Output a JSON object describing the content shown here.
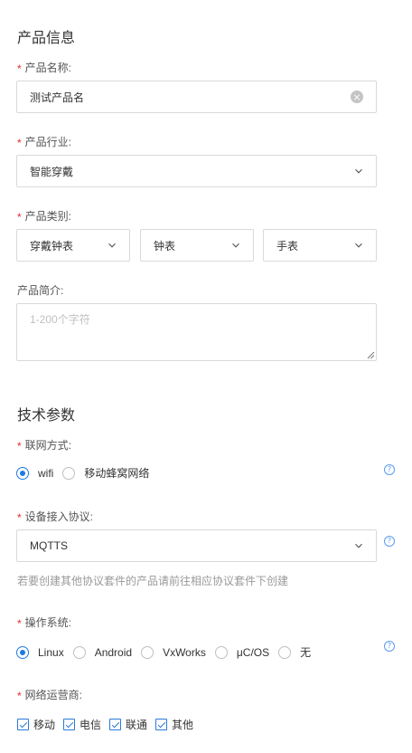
{
  "product_info": {
    "title": "产品信息",
    "name_label": "产品名称:",
    "name_value": "测试产品名",
    "industry_label": "产品行业:",
    "industry_value": "智能穿戴",
    "category_label": "产品类别:",
    "category_values": [
      "穿戴钟表",
      "钟表",
      "手表"
    ],
    "desc_label": "产品简介:",
    "desc_placeholder": "1-200个字符"
  },
  "tech_params": {
    "title": "技术参数",
    "network_label": "联网方式:",
    "network_options": [
      {
        "label": "wifi",
        "selected": true
      },
      {
        "label": "移动蜂窝网络",
        "selected": false
      }
    ],
    "protocol_label": "设备接入协议:",
    "protocol_value": "MQTTS",
    "protocol_hint": "若要创建其他协议套件的产品请前往相应协议套件下创建",
    "os_label": "操作系统:",
    "os_options": [
      {
        "label": "Linux",
        "selected": true
      },
      {
        "label": "Android",
        "selected": false
      },
      {
        "label": "VxWorks",
        "selected": false
      },
      {
        "label": "μC/OS",
        "selected": false
      },
      {
        "label": "无",
        "selected": false
      }
    ],
    "carrier_label": "网络运营商:",
    "carrier_options": [
      {
        "label": "移动",
        "checked": true
      },
      {
        "label": "电信",
        "checked": true
      },
      {
        "label": "联通",
        "checked": true
      },
      {
        "label": "其他",
        "checked": true
      }
    ]
  },
  "required_mark": "*",
  "help_icon_glyph": "?",
  "colors": {
    "accent": "#1f7ae0",
    "required": "#e3292b",
    "border": "#d9d9d9",
    "hint": "#999999"
  }
}
